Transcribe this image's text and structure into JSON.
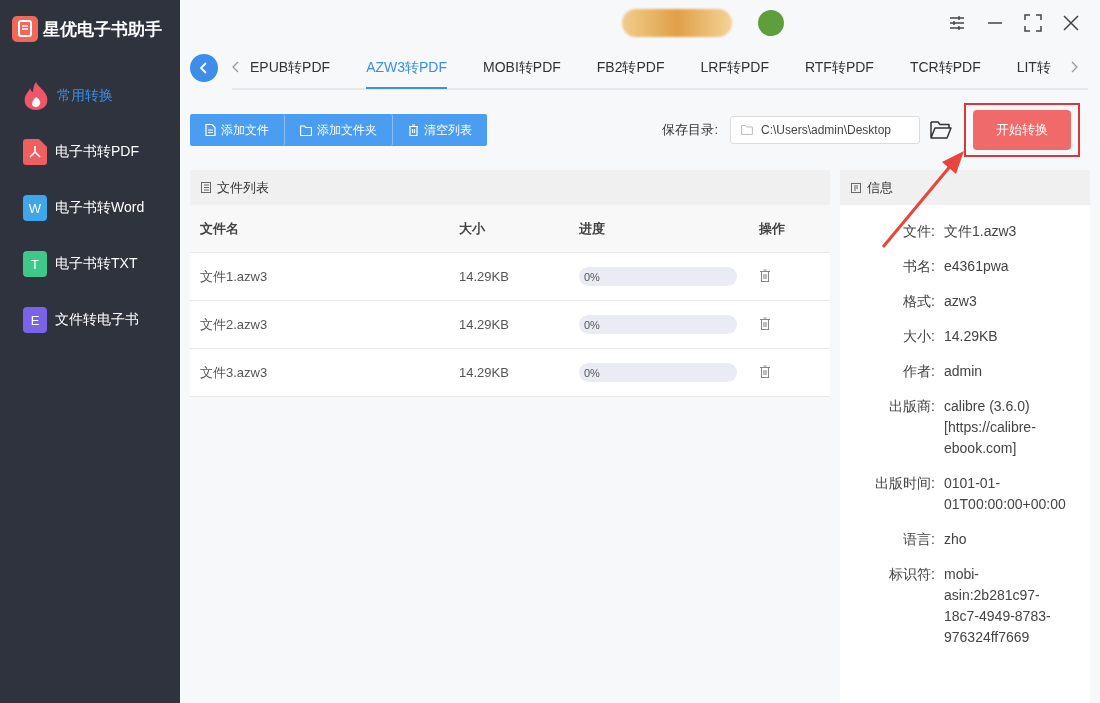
{
  "app": {
    "title": "星优电子书助手"
  },
  "sidebar": {
    "items": [
      {
        "label": "常用转换",
        "kind": "fire",
        "selected": true
      },
      {
        "label": "电子书转PDF",
        "kind": "pdf",
        "selected": false
      },
      {
        "label": "电子书转Word",
        "kind": "letter",
        "icon_text": "W",
        "color": "#3fa6ea",
        "selected": false
      },
      {
        "label": "电子书转TXT",
        "kind": "letter",
        "icon_text": "T",
        "color": "#3ec88a",
        "selected": false
      },
      {
        "label": "文件转电子书",
        "kind": "letter",
        "icon_text": "E",
        "color": "#7a63e6",
        "selected": false
      }
    ]
  },
  "tabs": [
    {
      "label": "EPUB转PDF",
      "selected": false
    },
    {
      "label": "AZW3转PDF",
      "selected": true
    },
    {
      "label": "MOBI转PDF",
      "selected": false
    },
    {
      "label": "FB2转PDF",
      "selected": false
    },
    {
      "label": "LRF转PDF",
      "selected": false
    },
    {
      "label": "RTF转PDF",
      "selected": false
    },
    {
      "label": "TCR转PDF",
      "selected": false
    },
    {
      "label": "LIT转",
      "selected": false
    }
  ],
  "toolbar": {
    "buttons": [
      {
        "label": "添加文件",
        "kind": "file"
      },
      {
        "label": "添加文件夹",
        "kind": "folder"
      },
      {
        "label": "清空列表",
        "kind": "trash"
      }
    ],
    "save_label": "保存目录:",
    "save_path": "C:\\Users\\admin\\Desktop",
    "start_button": "开始转换"
  },
  "file_list": {
    "title": "文件列表",
    "columns": [
      "文件名",
      "大小",
      "进度",
      "操作"
    ],
    "rows": [
      {
        "name": "文件1.azw3",
        "size": "14.29KB",
        "progress": "0%",
        "level": 0
      },
      {
        "name": "文件2.azw3",
        "size": "14.29KB",
        "progress": "0%",
        "level": 0
      },
      {
        "name": "文件3.azw3",
        "size": "14.29KB",
        "progress": "0%",
        "level": 0
      }
    ]
  },
  "info": {
    "title": "信息",
    "fields": [
      {
        "label": "文件:",
        "value": "文件1.azw3"
      },
      {
        "label": "书名:",
        "value": "e4361pwa"
      },
      {
        "label": "格式:",
        "value": "azw3"
      },
      {
        "label": "大小:",
        "value": "14.29KB"
      },
      {
        "label": "作者:",
        "value": "admin"
      },
      {
        "label": "出版商:",
        "value": "calibre (3.6.0) [https://calibre-ebook.com]"
      },
      {
        "label": "出版时间:",
        "value": "0101-01-01T00:00:00+00:00"
      },
      {
        "label": "语言:",
        "value": "zho"
      },
      {
        "label": "标识符:",
        "value": "mobi-asin:2b281c97-18c7-4949-8783-976324ff7669"
      }
    ]
  }
}
